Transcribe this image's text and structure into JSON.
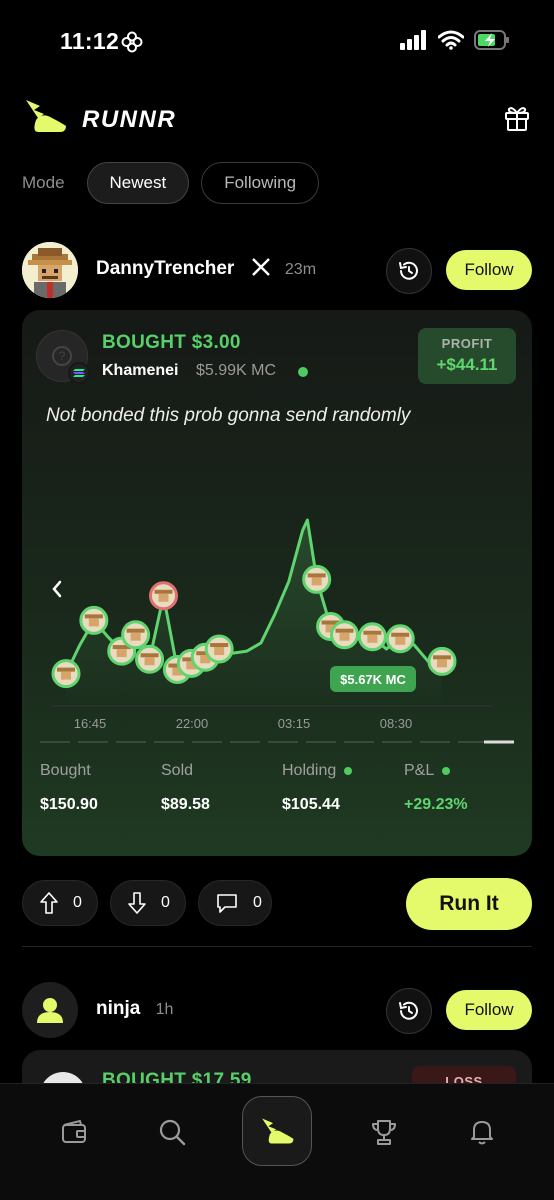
{
  "status_bar": {
    "time": "11:12"
  },
  "header": {
    "brand": "RUNNR"
  },
  "mode": {
    "label": "Mode",
    "options": [
      {
        "label": "Newest",
        "active": true
      },
      {
        "label": "Following",
        "active": false
      }
    ]
  },
  "posts": [
    {
      "username": "DannyTrencher",
      "time_ago": "23m",
      "follow_label": "Follow",
      "trade": {
        "action": "BOUGHT $3.00",
        "token": "Khamenei",
        "market_cap": "$5.99K MC",
        "profit_label": "PROFIT",
        "profit_value": "+$44.11"
      },
      "caption": "Not bonded this prob gonna send randomly",
      "stats": [
        {
          "label": "Bought",
          "value": "$150.90",
          "dot": false
        },
        {
          "label": "Sold",
          "value": "$89.58",
          "dot": false
        },
        {
          "label": "Holding",
          "value": "$105.44",
          "dot": true
        },
        {
          "label": "P&L",
          "value": "+29.23%",
          "dot": true
        }
      ],
      "upvotes": "0",
      "downvotes": "0",
      "comments": "0",
      "run_label": "Run It"
    },
    {
      "username": "ninja",
      "time_ago": "1h",
      "follow_label": "Follow",
      "trade": {
        "action": "BOUGHT $17.59",
        "result_label": "LOSS"
      }
    }
  ],
  "chart_data": {
    "type": "line",
    "x_tick_labels": [
      "16:45",
      "22:00",
      "03:15",
      "08:30"
    ],
    "x": [
      "14:15",
      "15:00",
      "15:45",
      "16:30",
      "17:15",
      "18:00",
      "18:45",
      "19:30",
      "20:15",
      "21:00",
      "21:45",
      "22:30",
      "23:15",
      "00:00",
      "00:45",
      "01:30",
      "02:15",
      "03:00",
      "03:15",
      "03:45",
      "04:30",
      "05:15",
      "06:00",
      "06:45",
      "07:30",
      "08:15",
      "09:00",
      "09:45",
      "10:30"
    ],
    "values": [
      0.8,
      2.2,
      3.4,
      2.6,
      1.9,
      2.7,
      1.5,
      4.6,
      1.0,
      1.3,
      1.6,
      2.0,
      1.8,
      1.9,
      2.3,
      3.7,
      5.3,
      7.8,
      8.3,
      5.4,
      3.1,
      2.7,
      2.5,
      2.6,
      2.0,
      2.5,
      2.2,
      1.4,
      1.4
    ],
    "current_label": "$5.67K MC",
    "colors": {
      "line": "#5fd46f",
      "sell_marker": "#e07070",
      "buy_marker": "#5fd46f"
    },
    "markers": [
      {
        "x": "14:15",
        "kind": "buy"
      },
      {
        "x": "15:45",
        "kind": "buy"
      },
      {
        "x": "17:15",
        "kind": "buy"
      },
      {
        "x": "18:00",
        "kind": "buy"
      },
      {
        "x": "18:45",
        "kind": "buy"
      },
      {
        "x": "19:30",
        "kind": "sell"
      },
      {
        "x": "20:15",
        "kind": "buy"
      },
      {
        "x": "21:00",
        "kind": "buy"
      },
      {
        "x": "21:45",
        "kind": "buy"
      },
      {
        "x": "22:30",
        "kind": "buy"
      },
      {
        "x": "03:45",
        "kind": "buy"
      },
      {
        "x": "04:30",
        "kind": "buy"
      },
      {
        "x": "05:15",
        "kind": "buy"
      },
      {
        "x": "06:45",
        "kind": "buy"
      },
      {
        "x": "08:15",
        "kind": "buy"
      },
      {
        "x": "10:30",
        "kind": "buy"
      }
    ]
  },
  "nav": [
    "wallet-icon",
    "search-icon",
    "runnr-icon",
    "trophy-icon",
    "bell-icon"
  ]
}
